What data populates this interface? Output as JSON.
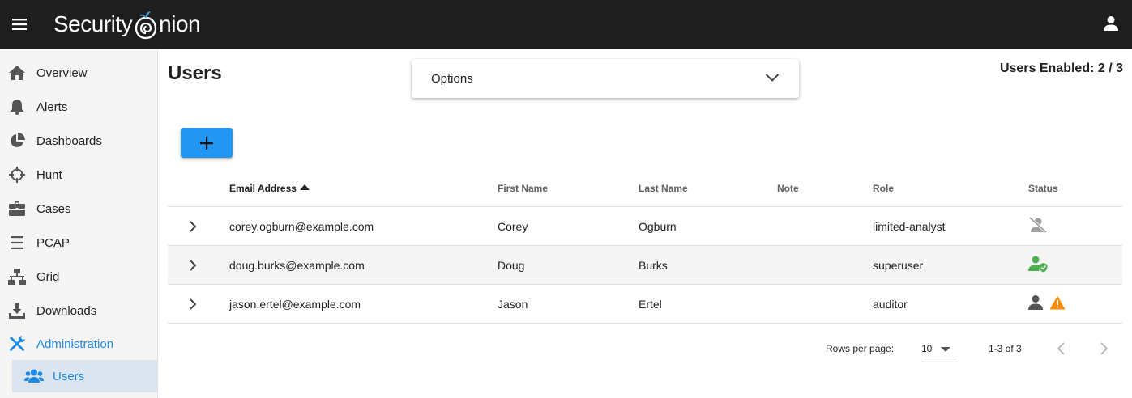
{
  "app": {
    "brand": "Security",
    "brand_suffix": "nion"
  },
  "sidebar": {
    "items": [
      {
        "label": "Overview",
        "icon": "home-icon"
      },
      {
        "label": "Alerts",
        "icon": "bell-icon"
      },
      {
        "label": "Dashboards",
        "icon": "pie-chart-icon"
      },
      {
        "label": "Hunt",
        "icon": "crosshairs-icon"
      },
      {
        "label": "Cases",
        "icon": "briefcase-icon"
      },
      {
        "label": "PCAP",
        "icon": "stream-icon"
      },
      {
        "label": "Grid",
        "icon": "network-icon"
      },
      {
        "label": "Downloads",
        "icon": "download-icon"
      },
      {
        "label": "Administration",
        "icon": "tools-icon"
      }
    ],
    "sub_item": {
      "label": "Users",
      "icon": "users-icon"
    }
  },
  "page": {
    "title": "Users",
    "options_label": "Options",
    "users_enabled": "Users Enabled: 2 / 3"
  },
  "table": {
    "headers": {
      "email": "Email Address",
      "first": "First Name",
      "last": "Last Name",
      "note": "Note",
      "role": "Role",
      "status": "Status"
    },
    "rows": [
      {
        "email": "corey.ogburn@example.com",
        "first": "Corey",
        "last": "Ogburn",
        "note": "",
        "role": "limited-analyst",
        "status": "disabled"
      },
      {
        "email": "doug.burks@example.com",
        "first": "Doug",
        "last": "Burks",
        "note": "",
        "role": "superuser",
        "status": "enabled-verified"
      },
      {
        "email": "jason.ertel@example.com",
        "first": "Jason",
        "last": "Ertel",
        "note": "",
        "role": "auditor",
        "status": "enabled-warning"
      }
    ]
  },
  "pagination": {
    "rows_per_page_label": "Rows per page:",
    "rows_per_page_value": "10",
    "range": "1-3 of 3"
  },
  "colors": {
    "accent": "#2196f3",
    "active_text": "#1e88e5",
    "active_bg": "#dbe5f0",
    "topbar": "#1e1e1e",
    "success": "#4caf50",
    "warning": "#fb8c00"
  }
}
